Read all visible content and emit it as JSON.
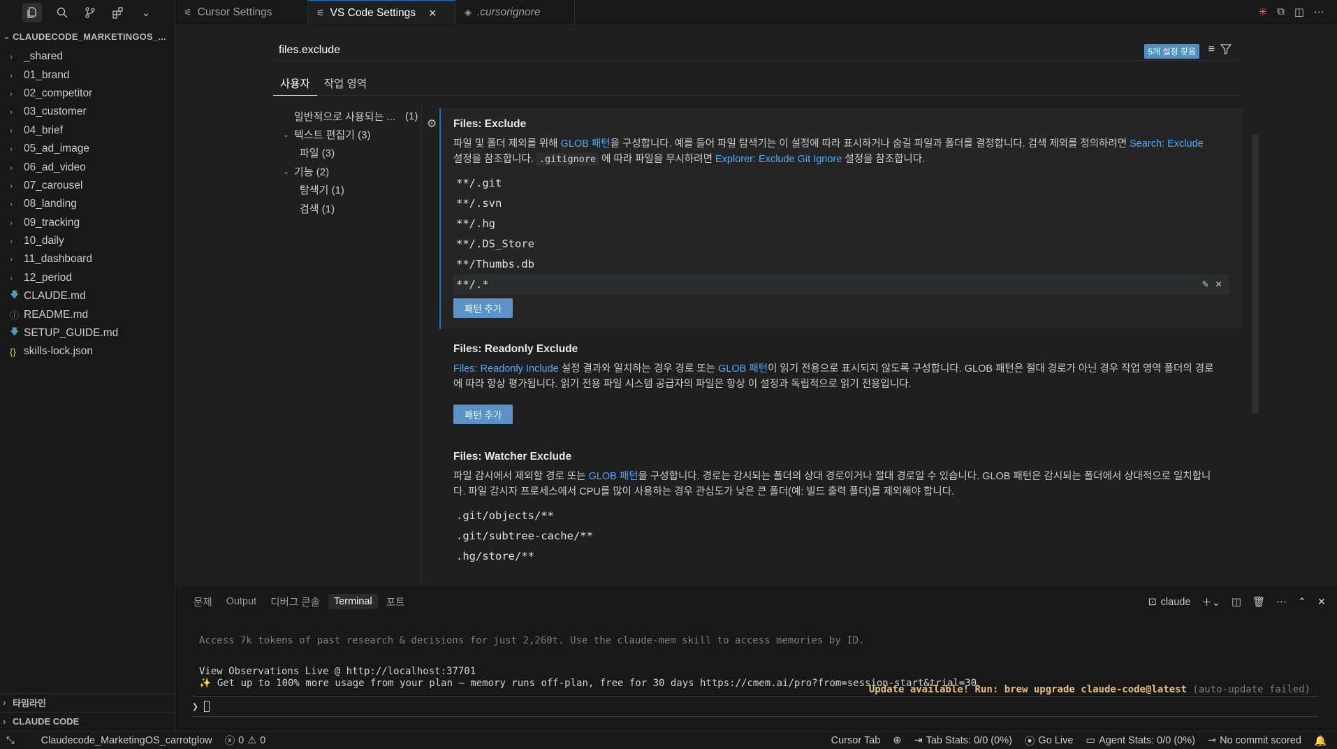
{
  "activity": {
    "icons": [
      "files-icon",
      "search-icon",
      "source-control-icon",
      "extensions-icon",
      "chevron-down-icon"
    ]
  },
  "explorer": {
    "title": "CLAUDECODE_MARKETINGOS_...",
    "items": [
      {
        "label": "_shared",
        "kind": "folder"
      },
      {
        "label": "01_brand",
        "kind": "folder"
      },
      {
        "label": "02_competitor",
        "kind": "folder"
      },
      {
        "label": "03_customer",
        "kind": "folder"
      },
      {
        "label": "04_brief",
        "kind": "folder"
      },
      {
        "label": "05_ad_image",
        "kind": "folder"
      },
      {
        "label": "06_ad_video",
        "kind": "folder"
      },
      {
        "label": "07_carousel",
        "kind": "folder"
      },
      {
        "label": "08_landing",
        "kind": "folder"
      },
      {
        "label": "09_tracking",
        "kind": "folder"
      },
      {
        "label": "10_daily",
        "kind": "folder"
      },
      {
        "label": "11_dashboard",
        "kind": "folder"
      },
      {
        "label": "12_period",
        "kind": "folder"
      },
      {
        "label": "CLAUDE.md",
        "kind": "md"
      },
      {
        "label": "README.md",
        "kind": "info"
      },
      {
        "label": "SETUP_GUIDE.md",
        "kind": "md"
      },
      {
        "label": "skills-lock.json",
        "kind": "json"
      }
    ],
    "timeline_label": "타임라인",
    "claude_code_label": "CLAUDE CODE"
  },
  "tabs": [
    {
      "label": "Cursor Settings"
    },
    {
      "label": "VS Code Settings"
    },
    {
      "label": ".cursorignore"
    }
  ],
  "settings": {
    "search_value": "files.exclude",
    "found_badge": "5개 설정 찾음",
    "scope_tabs": [
      "사용자",
      "작업 영역"
    ],
    "toc": [
      {
        "label": "일반적으로 사용되는 ...",
        "count": "(1)"
      },
      {
        "label": "텍스트 편집기 (3)"
      },
      {
        "label": "파일 (3)"
      },
      {
        "label": "기능 (2)"
      },
      {
        "label": "탐색기 (1)"
      },
      {
        "label": "검색 (1)"
      }
    ],
    "exclude": {
      "title": "Files: Exclude",
      "d1": "파일 및 폴더 제외를 위해 ",
      "d1_link": "GLOB 패턴",
      "d2": "을 구성합니다. 예를 들어 파일 탐색기는 이 설정에 따라 표시하거나 숨길 파일과 폴더를 결정합니다. 검색 제외를 정의하려면 ",
      "d2_link": "Search: Exclude",
      "d3": " 설정을 참조합니다. ",
      "d3_code": ".gitignore",
      "d4": " 에 따라 파일을 무시하려면 ",
      "d4_link": "Explorer: Exclude Git Ignore",
      "d5": " 설정을 참조합니다.",
      "patterns": [
        "**/.git",
        "**/.svn",
        "**/.hg",
        "**/.DS_Store",
        "**/Thumbs.db",
        "**/.*"
      ],
      "add_label": "패턴 추가"
    },
    "readonly": {
      "title": "Files: Readonly Exclude",
      "d1_link": "Files: Readonly Include",
      "d1": " 설정 결과와 일치하는 경우 경로 또는 ",
      "d2_link": "GLOB 패턴",
      "d2": "이 읽기 전용으로 표시되지 않도록 구성합니다. GLOB 패턴은 절대 경로가 아닌 경우 작업 영역 폴더의 경로에 따라 항상 평가됩니다. 읽기 전용 파일 시스템 공급자의 파일은 항상 이 설정과 독립적으로 읽기 전용입니다.",
      "add_label": "패턴 추가"
    },
    "watcher": {
      "title": "Files: Watcher Exclude",
      "d1": "파일 감시에서 제외할 경로 또는 ",
      "d1_link": "GLOB 패턴",
      "d2": "을 구성합니다. 경로는 감시되는 폴더의 상대 경로이거나 절대 경로일 수 있습니다. GLOB 패턴은 감시되는 폴더에서 상대적으로 일치합니다. 파일 감시자 프로세스에서 CPU를 많이 사용하는 경우 관심도가 낮은 큰 폴더(예: 빌드 출력 폴더)를 제외해야 합니다.",
      "patterns": [
        ".git/objects/**",
        ".git/subtree-cache/**",
        ".hg/store/**"
      ]
    }
  },
  "panel": {
    "tabs": [
      "문제",
      "Output",
      "디버그 콘솔",
      "Terminal",
      "포트"
    ],
    "terminal_name": "claude",
    "line1": "Access 7k tokens of past research & decisions for just 2,260t. Use the claude-mem skill to access memories by ID.",
    "line2": "View Observations Live @ http://localhost:37701",
    "line3": "✨ Get up to 100% more usage from your plan — memory runs off-plan, free for 30 days https://cmem.ai/pro?from=session-start&trial=30",
    "update_text": "Update available! Run: brew upgrade claude-code@latest",
    "update_suffix": " (auto-update failed)",
    "prompt": "❯"
  },
  "status": {
    "workspace": "Claudecode_MarketingOS_carrotglow",
    "errors": "0",
    "warnings": "0",
    "cursor_tab": "Cursor Tab",
    "tab_stats": "Tab Stats: 0/0 (0%)",
    "go_live": "Go Live",
    "agent_stats": "Agent Stats: 0/0 (0%)",
    "commit": "No commit scored"
  },
  "colors": {
    "accent": "#0078d4",
    "link": "#4daafc",
    "button": "#5b92c8",
    "update": "#e5c07b"
  }
}
